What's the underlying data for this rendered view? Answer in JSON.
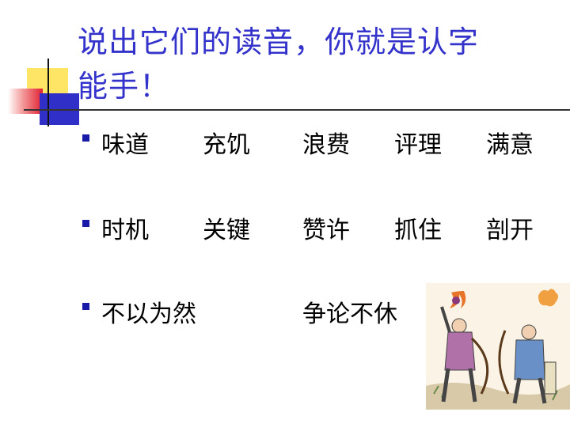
{
  "title": {
    "line1": "说出它们的读音，你就是认字",
    "line2": "能手！"
  },
  "rows": [
    {
      "words": [
        "味道",
        "充饥",
        "浪费",
        "评理",
        "满意"
      ]
    },
    {
      "words": [
        "时机",
        "关键",
        "赞许",
        "抓住",
        "剖开"
      ]
    },
    {
      "words": [
        "不以为然",
        "争论不休"
      ]
    }
  ]
}
